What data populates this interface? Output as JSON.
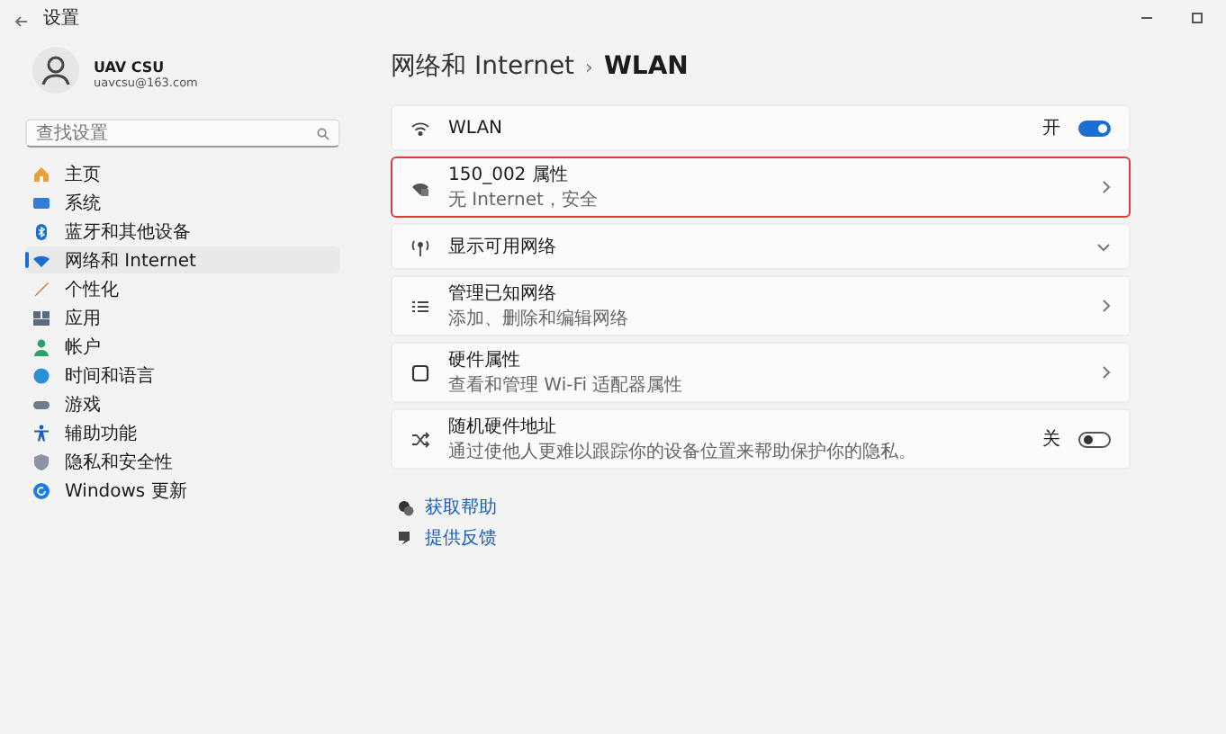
{
  "window": {
    "title": "设置"
  },
  "user": {
    "name": "UAV CSU",
    "email": "uavcsu@163.com"
  },
  "search": {
    "placeholder": "查找设置"
  },
  "sidebar": {
    "items": [
      {
        "label": "主页",
        "selected": false
      },
      {
        "label": "系统",
        "selected": false
      },
      {
        "label": "蓝牙和其他设备",
        "selected": false
      },
      {
        "label": "网络和 Internet",
        "selected": true
      },
      {
        "label": "个性化",
        "selected": false
      },
      {
        "label": "应用",
        "selected": false
      },
      {
        "label": "帐户",
        "selected": false
      },
      {
        "label": "时间和语言",
        "selected": false
      },
      {
        "label": "游戏",
        "selected": false
      },
      {
        "label": "辅助功能",
        "selected": false
      },
      {
        "label": "隐私和安全性",
        "selected": false
      },
      {
        "label": "Windows 更新",
        "selected": false
      }
    ]
  },
  "breadcrumb": {
    "parent": "网络和 Internet",
    "separator": "›",
    "current": "WLAN"
  },
  "cards": [
    {
      "kind": "toggle",
      "title": "WLAN",
      "state_label": "开",
      "on": true,
      "highlighted": false
    },
    {
      "kind": "link",
      "title": "150_002 属性",
      "subtitle": "无 Internet，安全",
      "highlighted": true
    },
    {
      "kind": "expand",
      "title": "显示可用网络",
      "highlighted": false
    },
    {
      "kind": "link",
      "title": "管理已知网络",
      "subtitle": "添加、删除和编辑网络",
      "highlighted": false
    },
    {
      "kind": "link",
      "title": "硬件属性",
      "subtitle": "查看和管理 Wi-Fi 适配器属性",
      "highlighted": false
    },
    {
      "kind": "toggle",
      "title": "随机硬件地址",
      "subtitle": "通过使他人更难以跟踪你的设备位置来帮助保护你的隐私。",
      "state_label": "关",
      "on": false,
      "highlighted": false
    }
  ],
  "links": [
    {
      "label": "获取帮助"
    },
    {
      "label": "提供反馈"
    }
  ]
}
